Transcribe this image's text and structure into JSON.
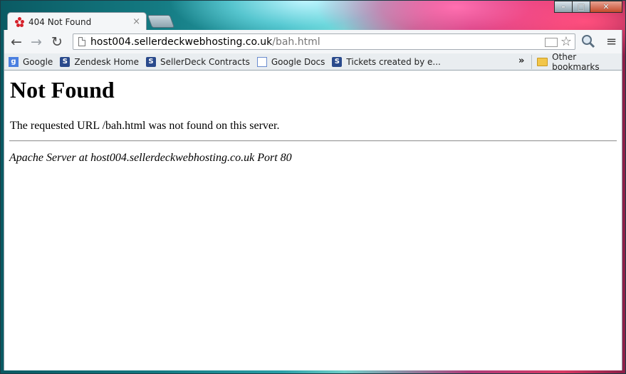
{
  "window": {
    "controls": {
      "minimize": "–",
      "maximize": "□",
      "close": "✕"
    }
  },
  "tab": {
    "title": "404 Not Found",
    "close": "×"
  },
  "toolbar": {
    "back": "←",
    "forward": "→",
    "reload": "↻",
    "url_host": "host004.sellerdeckwebhosting.co.uk",
    "url_path": "/bah.html",
    "star": "☆",
    "menu": "≡"
  },
  "bookmarks": {
    "items": [
      {
        "label": "Google",
        "icon": "google-icon"
      },
      {
        "label": "Zendesk Home",
        "icon": "sellerdeck-icon"
      },
      {
        "label": "SellerDeck Contracts",
        "icon": "sellerdeck-icon"
      },
      {
        "label": "Google Docs",
        "icon": "docs-icon"
      },
      {
        "label": "Tickets created by e...",
        "icon": "sellerdeck-icon"
      }
    ],
    "chevron": "»",
    "other": "Other bookmarks"
  },
  "page": {
    "heading": "Not Found",
    "message": "The requested URL /bah.html was not found on this server.",
    "address": "Apache Server at host004.sellerdeckwebhosting.co.uk Port 80"
  }
}
